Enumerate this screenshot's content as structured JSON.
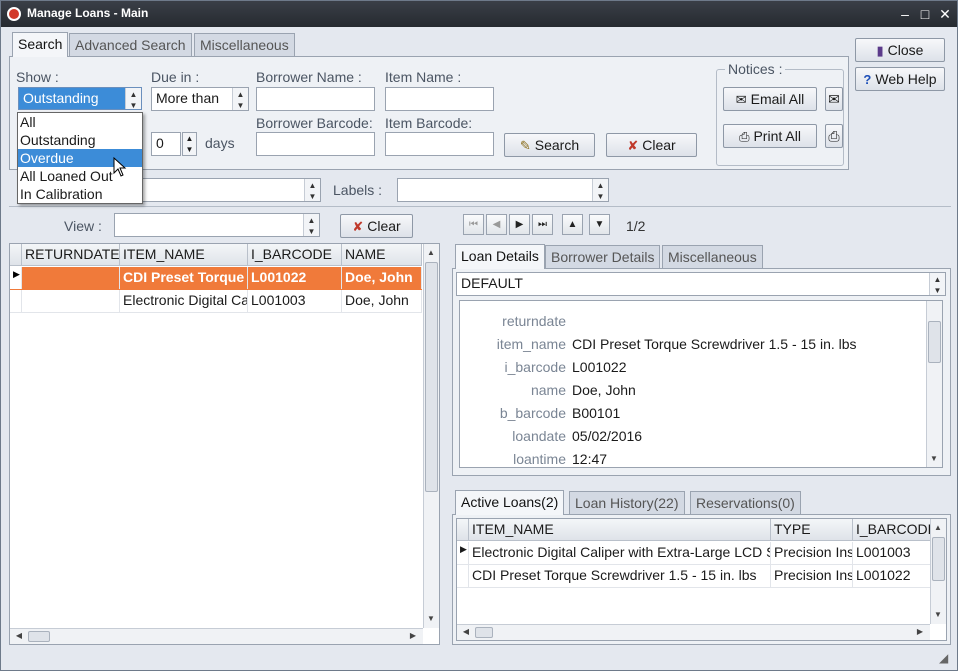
{
  "window": {
    "title": "Manage Loans - Main"
  },
  "search_tabs": [
    "Search",
    "Advanced Search",
    "Miscellaneous"
  ],
  "show": {
    "label": "Show :",
    "value": "Outstanding",
    "options": [
      "All",
      "Outstanding",
      "Overdue",
      "All Loaned Out",
      "In Calibration"
    ],
    "highlighted": "Overdue"
  },
  "due_in": {
    "label": "Due in :",
    "value": "More than",
    "days_value": "0",
    "days_label": "days"
  },
  "borrower_name": {
    "label": "Borrower Name :"
  },
  "item_name": {
    "label": "Item Name :"
  },
  "borrower_barcode": {
    "label": "Borrower Barcode:"
  },
  "item_barcode": {
    "label": "Item Barcode:"
  },
  "buttons": {
    "search": "Search",
    "clear": "Clear",
    "close": "Close",
    "web_help": "Web Help",
    "view_clear": "Clear"
  },
  "notices": {
    "label": "Notices :",
    "email_all": "Email All",
    "print_all": "Print All"
  },
  "labels": {
    "label": "Labels :"
  },
  "view": {
    "label": "View :"
  },
  "pager": {
    "text": "1/2"
  },
  "loans_grid": {
    "columns": [
      "RETURNDATE",
      "ITEM_NAME",
      "I_BARCODE",
      "NAME"
    ],
    "rows": [
      {
        "returndate": "",
        "item_name": "CDI Preset Torque",
        "i_barcode": "L001022",
        "name": "Doe, John",
        "selected": true
      },
      {
        "returndate": "",
        "item_name": "Electronic Digital Cal",
        "i_barcode": "L001003",
        "name": "Doe, John",
        "selected": false
      }
    ]
  },
  "detail_tabs": [
    "Loan Details",
    "Borrower Details",
    "Miscellaneous"
  ],
  "detail_view": "DEFAULT",
  "details": [
    {
      "key": "returndate",
      "value": ""
    },
    {
      "key": "item_name",
      "value": "CDI Preset Torque Screwdriver 1.5 - 15 in. lbs"
    },
    {
      "key": "i_barcode",
      "value": "L001022"
    },
    {
      "key": "name",
      "value": "Doe, John"
    },
    {
      "key": "b_barcode",
      "value": "B00101"
    },
    {
      "key": "loandate",
      "value": "05/02/2016"
    },
    {
      "key": "loantime",
      "value": "12:47"
    }
  ],
  "bottom_tabs": [
    "Active Loans(2)",
    "Loan History(22)",
    "Reservations(0)"
  ],
  "active_loans": {
    "columns": [
      "ITEM_NAME",
      "TYPE",
      "I_BARCODE"
    ],
    "rows": [
      {
        "item_name": "Electronic Digital Caliper with Extra-Large LCD S",
        "type": "Precision Ins",
        "i_barcode": "L001003"
      },
      {
        "item_name": "CDI Preset Torque Screwdriver 1.5 - 15 in. lbs",
        "type": "Precision Ins",
        "i_barcode": "L001022"
      }
    ]
  },
  "colors": {
    "selected_row": "#f07a3a",
    "highlight": "#3c8cd8",
    "titlebar": "#2c3036"
  }
}
